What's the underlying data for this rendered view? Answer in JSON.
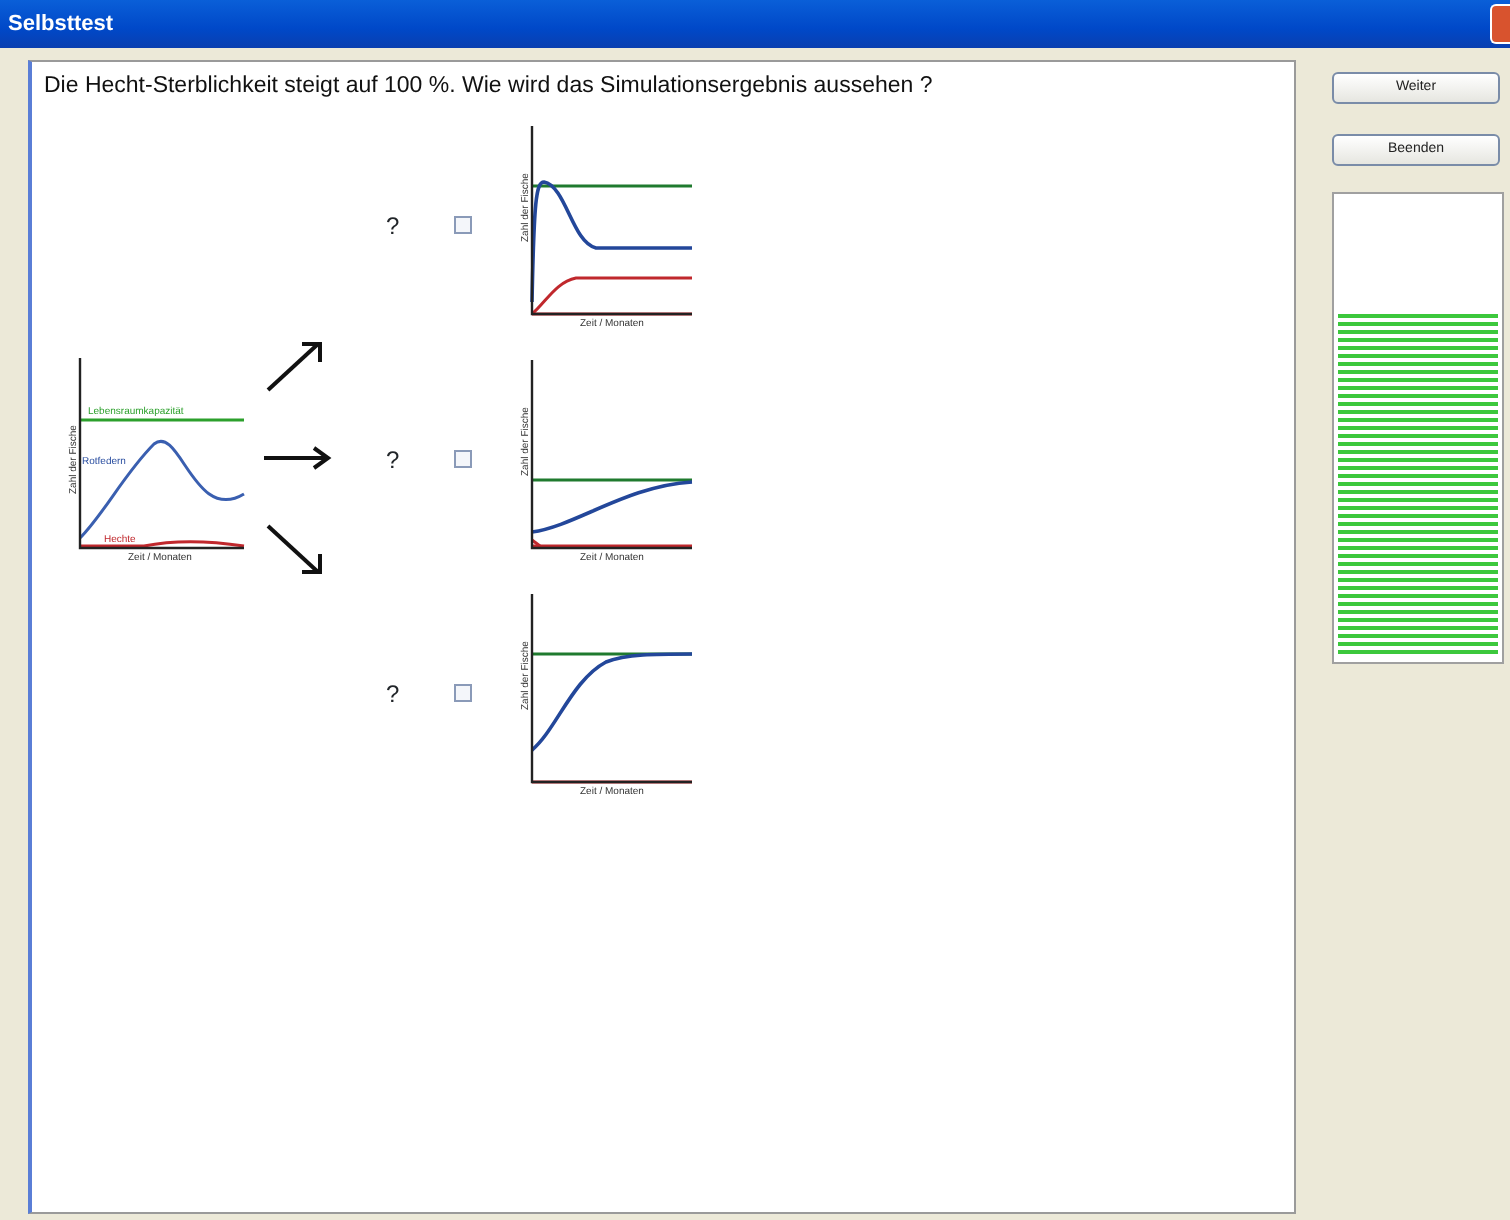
{
  "window": {
    "title": "Selbsttest"
  },
  "question": "Die Hecht-Sterblichkeit steigt auf 100 %.  Wie wird das Simulationsergebnis aussehen ?",
  "start_graph": {
    "capacity_label": "Lebensraumkapazität",
    "prey_label": "Rotfedern",
    "predator_label": "Hechte",
    "y_label": "Zahl der Fische",
    "x_label": "Zeit / Monaten"
  },
  "options": [
    {
      "kind": "overshoot",
      "mark": "?",
      "checked": false,
      "y_label": "Zahl der Fische",
      "x_label": "Zeit / Monaten"
    },
    {
      "kind": "slow-rise",
      "mark": "?",
      "checked": false,
      "y_label": "Zahl der Fische",
      "x_label": "Zeit / Monaten"
    },
    {
      "kind": "s-curve",
      "mark": "?",
      "checked": false,
      "y_label": "Zahl der Fische",
      "x_label": "Zeit / Monaten"
    }
  ],
  "buttons": [
    "Weiter",
    "Beenden"
  ],
  "progress": {
    "level": 0.75
  }
}
